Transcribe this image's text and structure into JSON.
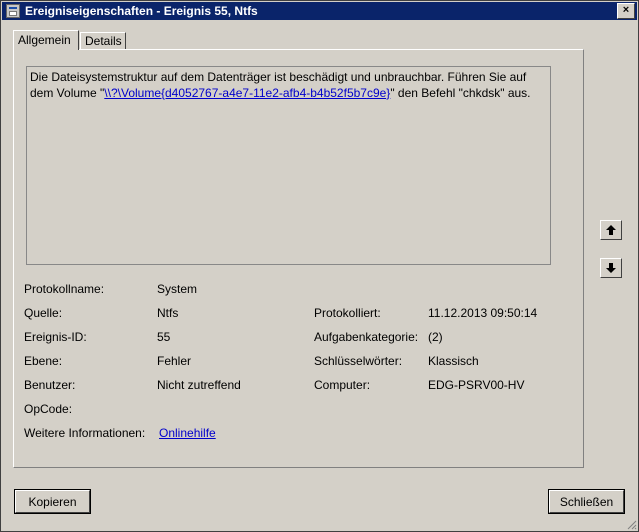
{
  "window": {
    "title": "Ereigniseigenschaften - Ereignis 55, Ntfs",
    "close": "×"
  },
  "tabs": [
    {
      "label": "Allgemein",
      "active": true
    },
    {
      "label": "Details",
      "active": false
    }
  ],
  "description": {
    "part1": "Die Dateisystemstruktur auf dem Datenträger ist beschädigt und unbrauchbar. Führen Sie auf dem Volume \"",
    "link": "\\\\?\\Volume{d4052767-a4e7-11e2-afb4-b4b52f5b7c9e}",
    "part2": "\" den Befehl \"chkdsk\" aus."
  },
  "fields": {
    "logname": {
      "label": "Protokollname:",
      "value": "System"
    },
    "source": {
      "label": "Quelle:",
      "value": "Ntfs"
    },
    "logged": {
      "label": "Protokolliert:",
      "value": "11.12.2013 09:50:14"
    },
    "eventid": {
      "label": "Ereignis-ID:",
      "value": "55"
    },
    "category": {
      "label": "Aufgabenkategorie:",
      "value": "(2)"
    },
    "level": {
      "label": "Ebene:",
      "value": "Fehler"
    },
    "keywords": {
      "label": "Schlüsselwörter:",
      "value": "Klassisch"
    },
    "user": {
      "label": "Benutzer:",
      "value": "Nicht zutreffend"
    },
    "computer": {
      "label": "Computer:",
      "value": "EDG-PSRV00-HV"
    },
    "opcode": {
      "label": "OpCode:",
      "value": ""
    },
    "moreinfo": {
      "label": "Weitere Informationen:",
      "value": "Onlinehilfe"
    }
  },
  "buttons": {
    "copy": "Kopieren",
    "close": "Schließen"
  },
  "colors": {
    "titlebar": "#0a246a",
    "face": "#d4d0c8",
    "link": "#0000cc"
  }
}
